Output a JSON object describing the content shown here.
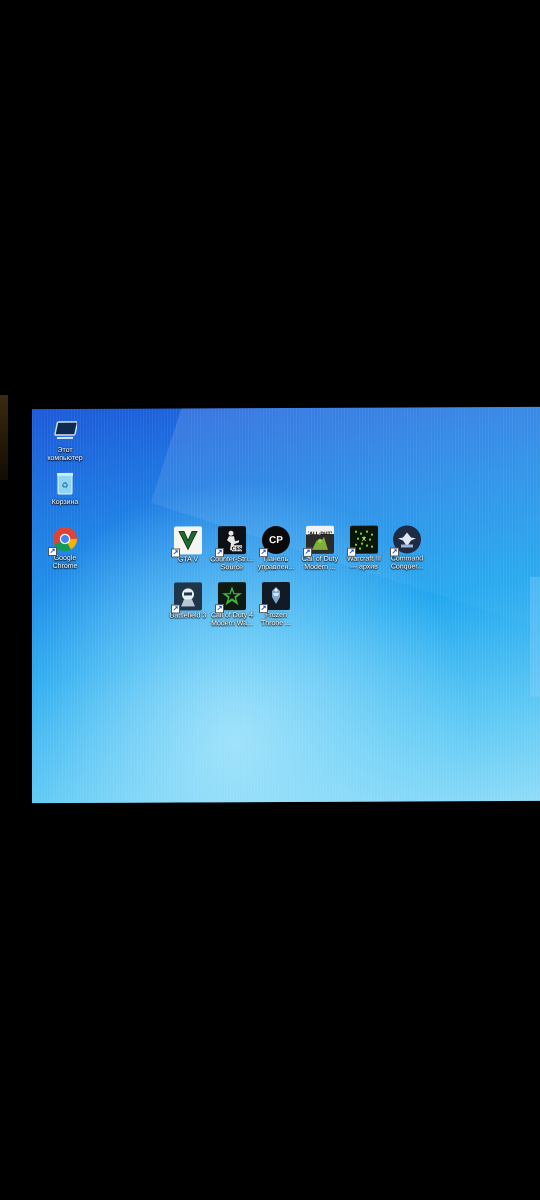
{
  "desktop": {
    "system_icons": [
      {
        "label": "Этот\nкомпьютер",
        "icon": "this-pc-icon"
      },
      {
        "label": "Корзина",
        "icon": "recycle-bin-icon"
      },
      {
        "label": "Google\nChrome",
        "icon": "chrome-icon"
      }
    ],
    "app_icons": [
      {
        "label": "GTA V",
        "icon": "gta-v-icon"
      },
      {
        "label": "Counter-Stri...\nSource",
        "icon": "counter-strike-source-icon"
      },
      {
        "label": "Панель\nуправлен...",
        "icon": "control-panel-icon",
        "glyph": "CP"
      },
      {
        "label": "Call of Duty\nModern ...",
        "icon": "call-of-duty-icon"
      },
      {
        "label": "Warcraft III\n— архив",
        "icon": "warcraft-iii-icon"
      },
      {
        "label": "Command\nConquer...",
        "icon": "command-conquer-icon"
      },
      {
        "label": "Battlefield 3",
        "icon": "battlefield-3-icon"
      },
      {
        "label": "Call of Duty 4\nModern Wa...",
        "icon": "call-of-duty-4-icon"
      },
      {
        "label": "Frozen\nThrone ...",
        "icon": "frozen-throne-icon"
      }
    ]
  }
}
